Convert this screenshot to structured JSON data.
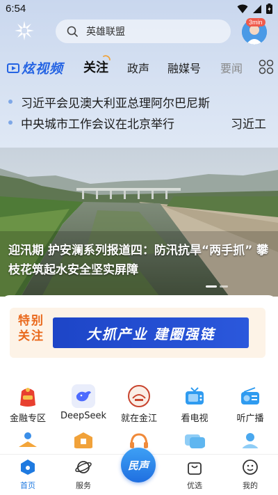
{
  "status_bar": {
    "time": "6:54"
  },
  "search": {
    "placeholder": "英雄联盟"
  },
  "avatar": {
    "timer_badge": "3min"
  },
  "tabs": [
    {
      "label": "炫视频"
    },
    {
      "label": "关注"
    },
    {
      "label": "政声"
    },
    {
      "label": "融媒号"
    },
    {
      "label": "要闻"
    }
  ],
  "headlines": [
    {
      "text": "习近平会见澳大利亚总理阿尔巴尼斯"
    },
    {
      "text": "中央城市工作会议在北京举行",
      "trail": "习近工"
    }
  ],
  "hero": {
    "caption": "迎汛期 护安澜系列报道四：防汛抗旱“两手抓” 攀枝花筑起水安全坚实屏障"
  },
  "promo": {
    "left_text": "特别关注",
    "banner_text": "大抓产业 建圈强链"
  },
  "quick_links": [
    {
      "label": "金融专区",
      "icon": "finance-icon",
      "color": "#e8402f"
    },
    {
      "label": "DeepSeek",
      "icon": "deepseek-icon",
      "color": "#4d6bfe"
    },
    {
      "label": "就在金江",
      "icon": "jinjiang-icon",
      "color": "#c8442e"
    },
    {
      "label": "看电视",
      "icon": "tv-icon",
      "color": "#2f9bf0"
    },
    {
      "label": "听广播",
      "icon": "radio-icon",
      "color": "#2f9bf0"
    }
  ],
  "quick_links_row2": [
    {
      "icon": "reading-icon",
      "color": "#3a8ee8"
    },
    {
      "icon": "enterprise-icon",
      "color": "#f1a23a"
    },
    {
      "icon": "headphone-icon",
      "color": "#f08a3a"
    },
    {
      "icon": "chat-icon",
      "color": "#5fb6f0"
    },
    {
      "icon": "person-icon",
      "color": "#4aa8ee"
    }
  ],
  "bottom_nav": [
    {
      "label": "首页",
      "icon": "home-icon"
    },
    {
      "label": "服务",
      "icon": "planet-icon"
    },
    {
      "label": "民声",
      "icon": "minsheng-icon"
    },
    {
      "label": "优选",
      "icon": "shopping-bag-icon"
    },
    {
      "label": "我的",
      "icon": "profile-icon"
    }
  ],
  "colors": {
    "accent": "#1f7ae0",
    "brand_blue": "#2463e3",
    "promo_orange": "#e9681b"
  }
}
